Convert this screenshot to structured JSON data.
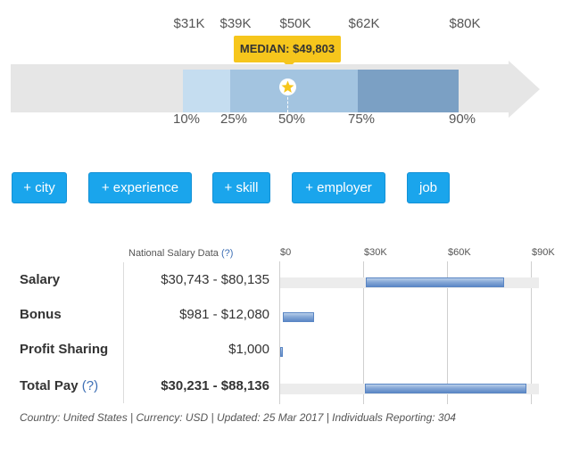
{
  "percentiles": {
    "top_labels": [
      "$31K",
      "$39K",
      "$50K",
      "$62K",
      "$80K"
    ],
    "bottom_labels": [
      "10%",
      "25%",
      "50%",
      "75%",
      "90%"
    ],
    "median_label": "MEDIAN: $49,803",
    "colors": {
      "track": "#e6e6e6",
      "p10_25": "#c5ddf0",
      "p25_75": "#a3c4e0",
      "p75_90": "#7ba0c4",
      "median": "#f6c61c"
    }
  },
  "filters": [
    "+ city",
    "+ experience",
    "+ skill",
    "+ employer",
    "job"
  ],
  "table": {
    "header": "National Salary Data",
    "header_help": "(?)",
    "axis_ticks": [
      "$0",
      "$30K",
      "$60K",
      "$90K"
    ],
    "rows": [
      {
        "label": "Salary",
        "help": "",
        "value": "$30,743 - $80,135",
        "min": 30743,
        "max": 80135
      },
      {
        "label": "Bonus",
        "help": "",
        "value": "$981 - $12,080",
        "min": 981,
        "max": 12080
      },
      {
        "label": "Profit Sharing",
        "help": "",
        "value": "$1,000",
        "min": 0,
        "max": 1000
      },
      {
        "label": "Total Pay",
        "help": "(?)",
        "value": "$30,231 - $88,136",
        "min": 30231,
        "max": 88136
      }
    ],
    "axis_max": 90000
  },
  "footer": "Country: United States | Currency: USD | Updated: 25 Mar 2017 | Individuals Reporting: 304"
}
